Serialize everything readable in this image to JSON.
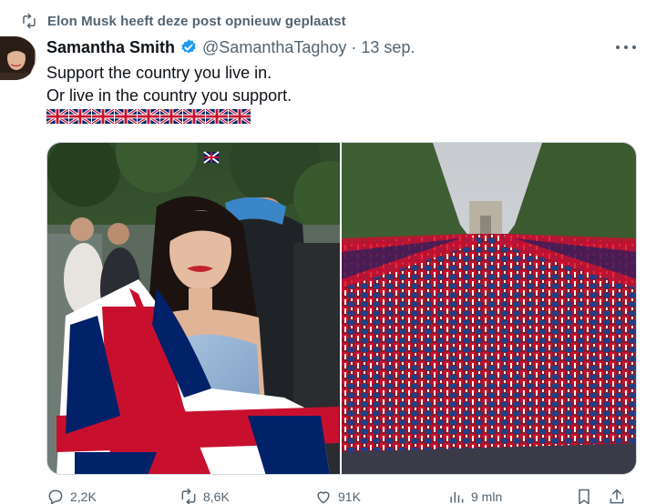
{
  "repost": {
    "icon": "repost-icon",
    "text": "Elon Musk heeft deze post opnieuw geplaatst"
  },
  "author": {
    "name": "Samantha Smith",
    "verified_icon": "verified-badge-icon",
    "handle": "@SamanthaTaghoy",
    "separator": "·",
    "date": "13 sep."
  },
  "post": {
    "line1": "Support the country you live in.",
    "line2": "Or live in the country you support.",
    "flag_count": 9,
    "flag_icon": "union-jack-flag-icon"
  },
  "actions": {
    "replies": "2,2K",
    "reposts": "8,6K",
    "likes": "91K",
    "views": "9 mln"
  },
  "colors": {
    "text": "#0f1419",
    "muted": "#536471",
    "verified": "#1d9bf0",
    "border": "#cfd9de"
  }
}
